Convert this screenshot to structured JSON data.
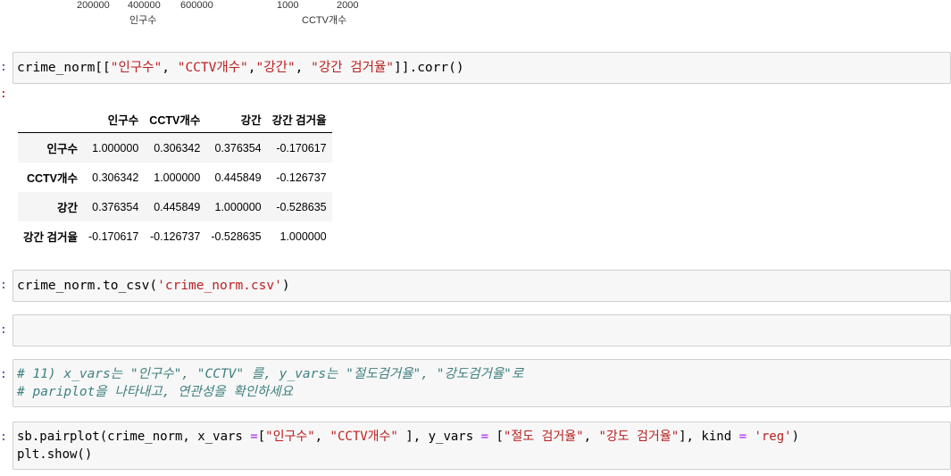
{
  "top_axes": {
    "plot1_ticks": [
      "200000",
      "400000",
      "600000"
    ],
    "plot1_xlabel": "인구수",
    "plot2_ticks": [
      "1000",
      "2000"
    ],
    "plot2_xlabel": "CCTV개수"
  },
  "cells": {
    "corr_cell": {
      "prompt": ":",
      "code_prefix": "crime_norm[[",
      "code_strings": [
        "\"인구수\"",
        "\"CCTV개수\"",
        "\"강간\"",
        "\"강간 검거율\""
      ],
      "code_suffix": "]].corr()"
    },
    "out_prompt": ":",
    "csv_cell": {
      "prompt": ":",
      "code_prefix": "crime_norm.to_csv(",
      "code_string": "'crime_norm.csv'",
      "code_suffix": ")"
    },
    "empty_cell": {
      "prompt": ":"
    },
    "comment_cell": {
      "prompt": ":",
      "line1": "# 11) x_vars는 \"인구수\", \"CCTV\" 를, y_vars는 \"절도검거율\", \"강도검거율\"로",
      "line2": "# pariplot을 나타내고, 연관성을 확인하세요"
    },
    "pairplot_cell": {
      "prompt": ":",
      "line1_a": "sb.pairplot(crime_norm, x_vars ",
      "line1_eq": "=",
      "line1_b": "[",
      "str1": "\"인구수\"",
      "line1_c": ", ",
      "str2": "\"CCTV개수\"",
      "line1_d": " ], y_vars ",
      "line1_eq2": "=",
      "line1_e": " [",
      "str3": "\"절도 검거율\"",
      "line1_f": ", ",
      "str4": "\"강도 검거율\"",
      "line1_g": "], kind ",
      "line1_eq3": "=",
      "line1_h": " ",
      "str5": "'reg'",
      "line1_i": ")",
      "line2": "plt.show()"
    }
  },
  "corr_table": {
    "columns": [
      "인구수",
      "CCTV개수",
      "강간",
      "강간 검거율"
    ],
    "rows": [
      {
        "index": "인구수",
        "values": [
          "1.000000",
          "0.306342",
          "0.376354",
          "-0.170617"
        ]
      },
      {
        "index": "CCTV개수",
        "values": [
          "0.306342",
          "1.000000",
          "0.445849",
          "-0.126737"
        ]
      },
      {
        "index": "강간",
        "values": [
          "0.376354",
          "0.445849",
          "1.000000",
          "-0.528635"
        ]
      },
      {
        "index": "강간 검거율",
        "values": [
          "-0.170617",
          "-0.126737",
          "-0.528635",
          "1.000000"
        ]
      }
    ]
  }
}
